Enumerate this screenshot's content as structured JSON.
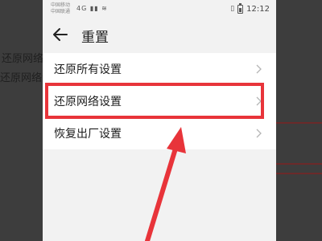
{
  "background": {
    "text_line_1": "还原网络",
    "text_line_2": "还原网络设"
  },
  "status_bar": {
    "carrier_1": "中国移动",
    "carrier_2": "中国联通",
    "signal_icons": "4G ▮▮ ≋",
    "time": "12:12"
  },
  "header": {
    "title": "重置"
  },
  "settings_list": [
    {
      "label": "还原所有设置"
    },
    {
      "label": "还原网络设置"
    },
    {
      "label": "恢复出厂设置"
    }
  ],
  "annotation": {
    "highlighted_item": "还原网络设置",
    "color": "#e8343a"
  },
  "colors": {
    "page_background": "#f2f2f2",
    "list_background": "#ffffff",
    "highlight_red": "#e8343a"
  }
}
